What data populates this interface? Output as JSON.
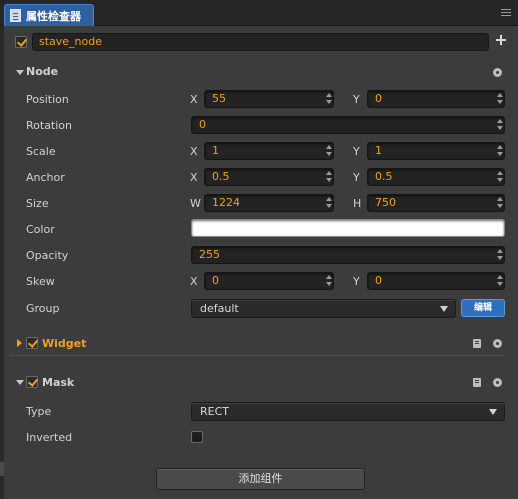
{
  "panel": {
    "tab_title": "属性检查器"
  },
  "node_name": "stave_node",
  "node_section": {
    "title": "Node",
    "position": {
      "label": "Position",
      "x_label": "X",
      "x": "55",
      "y_label": "Y",
      "y": "0"
    },
    "rotation": {
      "label": "Rotation",
      "value": "0"
    },
    "scale": {
      "label": "Scale",
      "x_label": "X",
      "x": "1",
      "y_label": "Y",
      "y": "1"
    },
    "anchor": {
      "label": "Anchor",
      "x_label": "X",
      "x": "0.5",
      "y_label": "Y",
      "y": "0.5"
    },
    "size": {
      "label": "Size",
      "w_label": "W",
      "w": "1224",
      "h_label": "H",
      "h": "750"
    },
    "color": {
      "label": "Color",
      "value": "#ffffff"
    },
    "opacity": {
      "label": "Opacity",
      "value": "255"
    },
    "skew": {
      "label": "Skew",
      "x_label": "X",
      "x": "0",
      "y_label": "Y",
      "y": "0"
    },
    "group": {
      "label": "Group",
      "value": "default",
      "edit_label": "编辑"
    }
  },
  "widget_section": {
    "title": "Widget",
    "enabled": true,
    "collapsed": true
  },
  "mask_section": {
    "title": "Mask",
    "enabled": true,
    "type": {
      "label": "Type",
      "value": "RECT"
    },
    "inverted": {
      "label": "Inverted",
      "checked": false
    }
  },
  "add_component_label": "添加组件",
  "colors": {
    "accent": "#f0a020",
    "tab_active": "#2f5fa0",
    "edit_button": "#2f6fbf"
  }
}
